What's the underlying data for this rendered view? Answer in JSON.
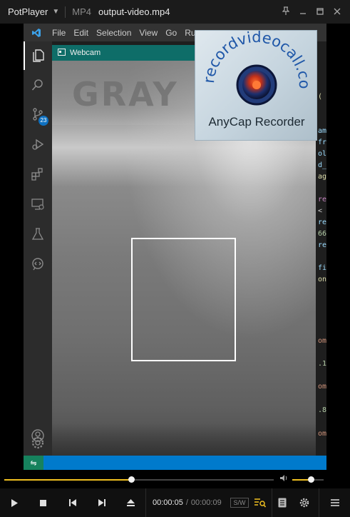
{
  "potplayer": {
    "app_name": "PotPlayer",
    "format": "MP4",
    "filename": "output-video.mp4",
    "window_controls": [
      "pin-icon",
      "minimize-icon",
      "maximize-icon",
      "close-icon"
    ]
  },
  "vscode": {
    "menu": [
      "File",
      "Edit",
      "Selection",
      "View",
      "Go",
      "Run"
    ],
    "activity_icons": [
      "explorer-icon",
      "search-icon",
      "source-control-icon",
      "run-debug-icon",
      "extensions-icon",
      "remote-explorer-icon",
      "testing-icon",
      "live-share-icon",
      "account-icon",
      "settings-icon"
    ],
    "source_control_badge": "23",
    "code_fragments": [
      {
        "text": "(",
        "color": "#dcdcaa"
      },
      {
        "text": "am",
        "color": "#9cdcfe"
      },
      {
        "text": "fr",
        "color": "#9cdcfe"
      },
      {
        "text": "ol",
        "color": "#9cdcfe"
      },
      {
        "text": "d_",
        "color": "#9cdcfe"
      },
      {
        "text": "ag",
        "color": "#dcdcaa"
      },
      {
        "text": "re",
        "color": "#c586c0"
      },
      {
        "text": "<",
        "color": "#cccccc"
      },
      {
        "text": "re",
        "color": "#9cdcfe"
      },
      {
        "text": "66",
        "color": "#b5cea8"
      },
      {
        "text": "re",
        "color": "#9cdcfe"
      },
      {
        "text": "fi",
        "color": "#9cdcfe"
      },
      {
        "text": "on",
        "color": "#dcdcaa"
      },
      {
        "text": "om",
        "color": "#ce9178"
      },
      {
        "text": ".1",
        "color": "#b5cea8"
      },
      {
        "text": "om",
        "color": "#ce9178"
      },
      {
        "text": ".8",
        "color": "#b5cea8"
      },
      {
        "text": "om",
        "color": "#ce9178"
      }
    ]
  },
  "webcam": {
    "title": "Webcam",
    "overlay_text": "GRAY"
  },
  "watermark": {
    "arc_text": "recordvideocall.com",
    "label": "AnyCap Recorder"
  },
  "playback": {
    "current_time": "00:00:05",
    "separator": "/",
    "total_time": "00:00:09",
    "sw_label": "S/W",
    "progress_fraction": 0.47,
    "volume_fraction": 0.6,
    "accent_color": "#f0c020"
  }
}
